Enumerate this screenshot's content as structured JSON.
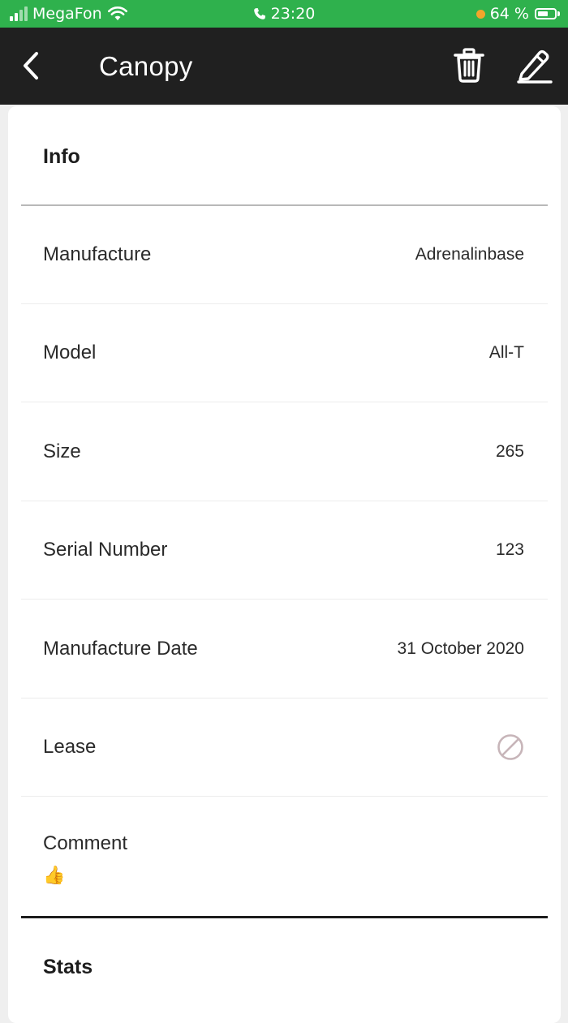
{
  "status_bar": {
    "carrier": "MegaFon",
    "time": "23:20",
    "battery": "64 %",
    "battery_level": 0.64
  },
  "header": {
    "title": "Canopy",
    "icons": {
      "back": "chevron-left-icon",
      "delete": "trash-icon",
      "edit": "pencil-icon"
    }
  },
  "colors": {
    "status_bar": "#2fb14d",
    "header": "#202020",
    "background": "#efefef",
    "card": "#ffffff",
    "battery_dot": "#f3a52b",
    "lease_icon": "#c7b5b9"
  },
  "info": {
    "title": "Info",
    "rows": [
      {
        "label": "Manufacture",
        "value": "Adrenalinbase"
      },
      {
        "label": "Model",
        "value": "All-T"
      },
      {
        "label": "Size",
        "value": "265"
      },
      {
        "label": "Serial Number",
        "value": "123"
      },
      {
        "label": "Manufacture Date",
        "value": "31 October 2020"
      },
      {
        "label": "Lease",
        "value_icon": "prohibited-icon"
      }
    ],
    "comment": {
      "label": "Comment",
      "value": "👍"
    }
  },
  "stats": {
    "title": "Stats"
  }
}
